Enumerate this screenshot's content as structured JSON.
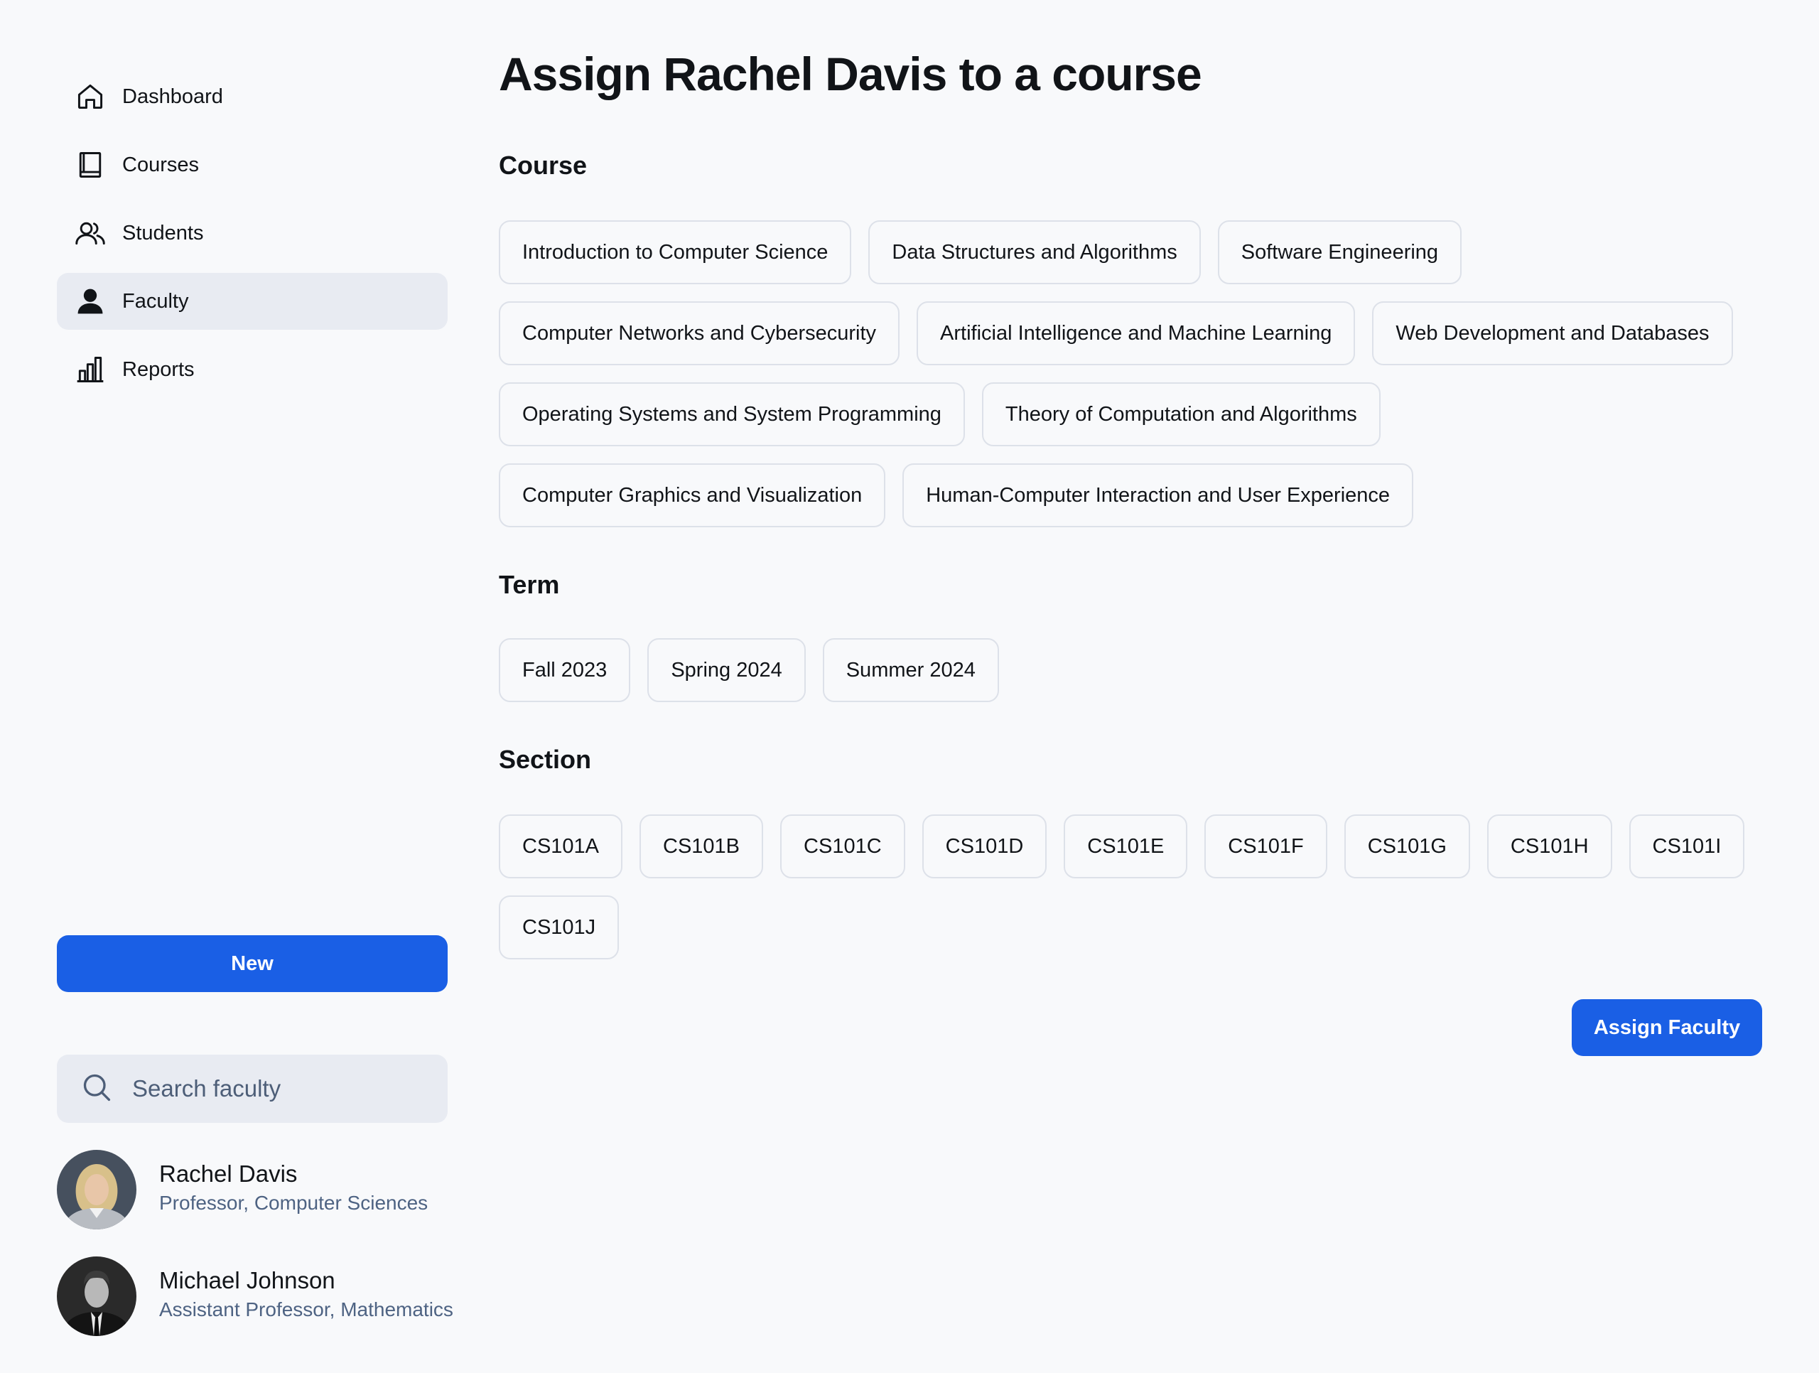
{
  "sidebar": {
    "nav": [
      {
        "label": "Dashboard",
        "icon": "home-icon"
      },
      {
        "label": "Courses",
        "icon": "book-icon"
      },
      {
        "label": "Students",
        "icon": "users-icon"
      },
      {
        "label": "Faculty",
        "icon": "user-icon",
        "active": true
      },
      {
        "label": "Reports",
        "icon": "bar-chart-icon"
      }
    ],
    "new_button": "New",
    "search_placeholder": "Search faculty",
    "faculty": [
      {
        "name": "Rachel Davis",
        "role": "Professor, Computer Sciences"
      },
      {
        "name": "Michael Johnson",
        "role": "Assistant Professor, Mathematics"
      }
    ]
  },
  "main": {
    "title": "Assign Rachel Davis to a course",
    "course_label": "Course",
    "courses": [
      "Introduction to Computer Science",
      "Data Structures and Algorithms",
      "Software Engineering",
      "Computer Networks and Cybersecurity",
      "Artificial Intelligence and Machine Learning",
      "Web Development and Databases",
      "Operating Systems and System Programming",
      "Theory of Computation and Algorithms",
      "Computer Graphics and Visualization",
      "Human-Computer Interaction and User Experience"
    ],
    "term_label": "Term",
    "terms": [
      "Fall 2023",
      "Spring 2024",
      "Summer 2024"
    ],
    "section_label": "Section",
    "sections": [
      "CS101A",
      "CS101B",
      "CS101C",
      "CS101D",
      "CS101E",
      "CS101F",
      "CS101G",
      "CS101H",
      "CS101I",
      "CS101J"
    ],
    "assign_button": "Assign Faculty"
  },
  "colors": {
    "accent": "#1a5fe5",
    "background": "#f8f9fb",
    "active_nav": "#e8ebf2",
    "muted_text": "#4e6383"
  }
}
